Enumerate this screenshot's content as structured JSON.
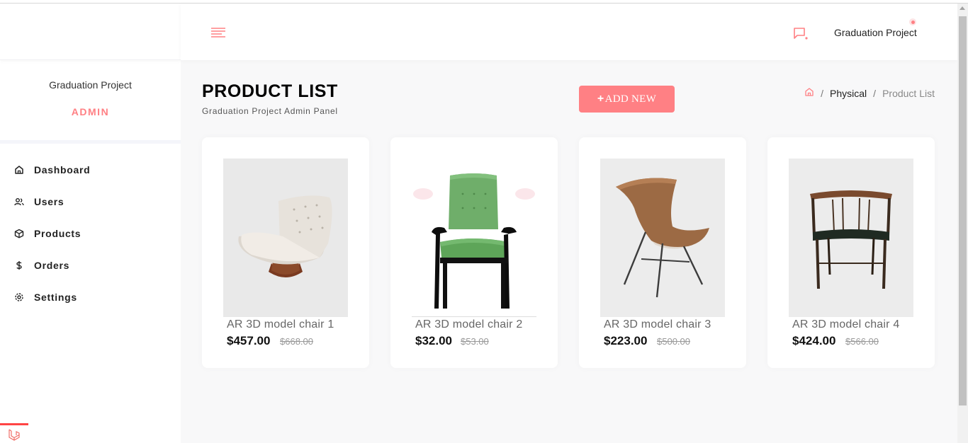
{
  "app": {
    "name": "Graduation Project"
  },
  "colors": {
    "accent": "#ff8084",
    "background": "#f8f8f9",
    "card": "#ffffff"
  },
  "sidebar": {
    "profile": {
      "name": "Graduation Project",
      "role": "ADMIN"
    },
    "items": [
      {
        "label": "Dashboard",
        "icon": "home-icon"
      },
      {
        "label": "Users",
        "icon": "users-icon"
      },
      {
        "label": "Products",
        "icon": "box-icon"
      },
      {
        "label": "Orders",
        "icon": "dollar-icon"
      },
      {
        "label": "Settings",
        "icon": "gear-icon"
      }
    ]
  },
  "header": {
    "menu_icon": "hamburger-icon",
    "message_icon": "message-icon",
    "user_name": "Graduation Project"
  },
  "page": {
    "title": "PRODUCT LIST",
    "subtitle": "Graduation Project Admin Panel",
    "add_button": {
      "plus": "+",
      "label": "ADD NEW"
    },
    "breadcrumb": {
      "home_icon": "home-icon",
      "sep": "/",
      "section": "Physical",
      "current": "Product List"
    }
  },
  "products": [
    {
      "title": "AR 3D model chair 1",
      "price": "$457.00",
      "old_price": "$668.00",
      "image": "lounge-chair"
    },
    {
      "title": "AR 3D model chair 2",
      "price": "$32.00",
      "old_price": "$53.00",
      "image": "green-armchair"
    },
    {
      "title": "AR 3D model chair 3",
      "price": "$223.00",
      "old_price": "$500.00",
      "image": "wood-chair"
    },
    {
      "title": "AR 3D model chair 4",
      "price": "$424.00",
      "old_price": "$566.00",
      "image": "dining-chair"
    }
  ]
}
